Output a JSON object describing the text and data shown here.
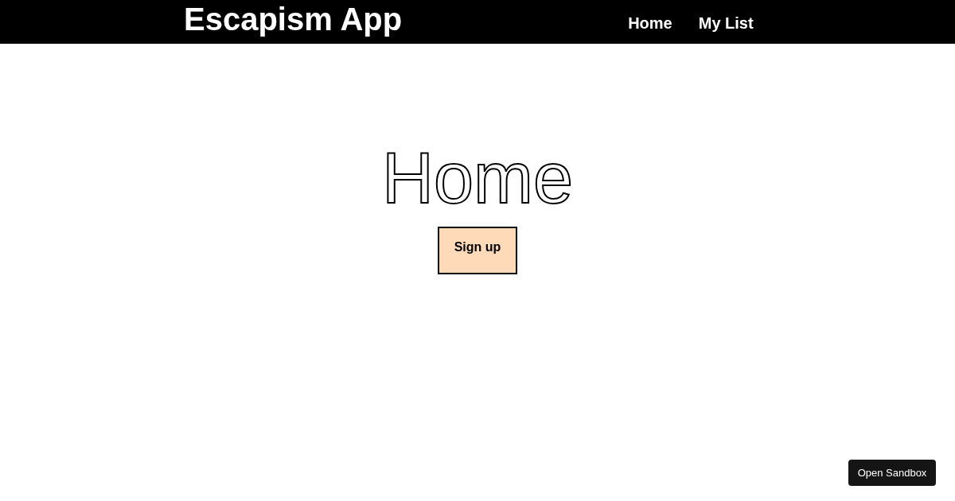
{
  "header": {
    "title": "Escapism App",
    "nav": [
      {
        "label": "Home"
      },
      {
        "label": "My List"
      }
    ]
  },
  "main": {
    "heading": "Home",
    "button": "Sign up"
  },
  "sandbox_button": "Open Sandbox"
}
